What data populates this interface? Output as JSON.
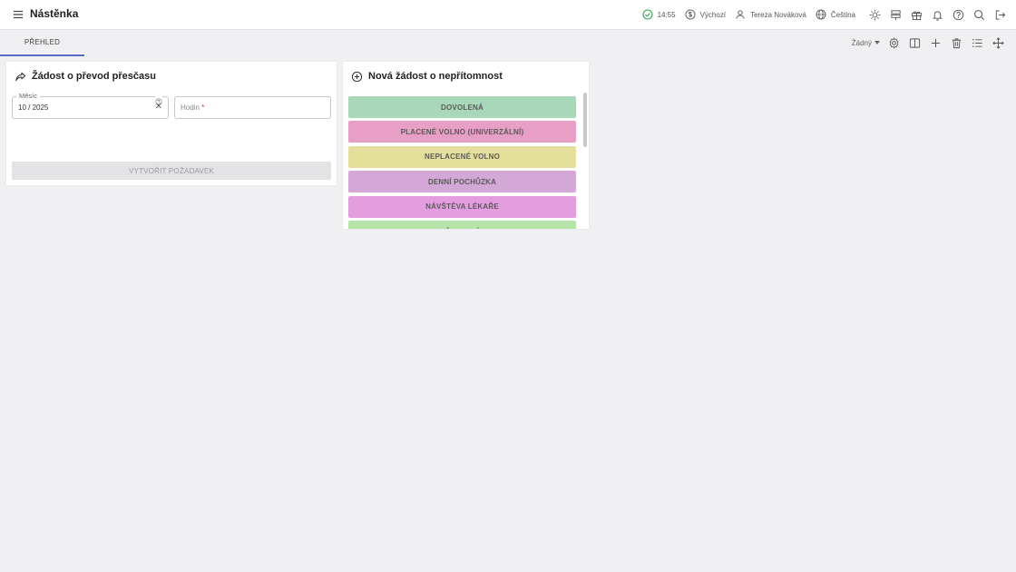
{
  "header": {
    "title": "Nástěnka",
    "time": "14:55",
    "mode": "Výchozí",
    "user": "Tereza Nováková",
    "language": "Čeština"
  },
  "tabs": [
    {
      "label": "PŘEHLED",
      "active": true
    }
  ],
  "toolbar": {
    "filter_value": "Žádný"
  },
  "overtime_card": {
    "title": "Žádost o převod přesčasu",
    "month_label": "Měsíc",
    "month_value": "10 / 2025",
    "hours_label": "Hodin",
    "hours_required_mark": "*",
    "submit_label": "VYTVOŘIT POŽADAVEK"
  },
  "absence_card": {
    "title": "Nová žádost o nepřítomnost",
    "types": [
      {
        "label": "DOVOLENÁ",
        "color": "#a8d8b9"
      },
      {
        "label": "PLACENÉ VOLNO (UNIVERZÁLNÍ)",
        "color": "#e79fc5"
      },
      {
        "label": "NEPLACENÉ VOLNO",
        "color": "#e4e09c"
      },
      {
        "label": "DENNÍ POCHŮZKA",
        "color": "#d4a8d6"
      },
      {
        "label": "NÁVŠTĚVA LÉKAŘE",
        "color": "#e49ee0"
      },
      {
        "label": "ŠKOLENÍ",
        "color": "#b6e3a8"
      }
    ]
  },
  "colors": {
    "accent": "#5a68c8",
    "status_ok": "#2fa84f"
  }
}
